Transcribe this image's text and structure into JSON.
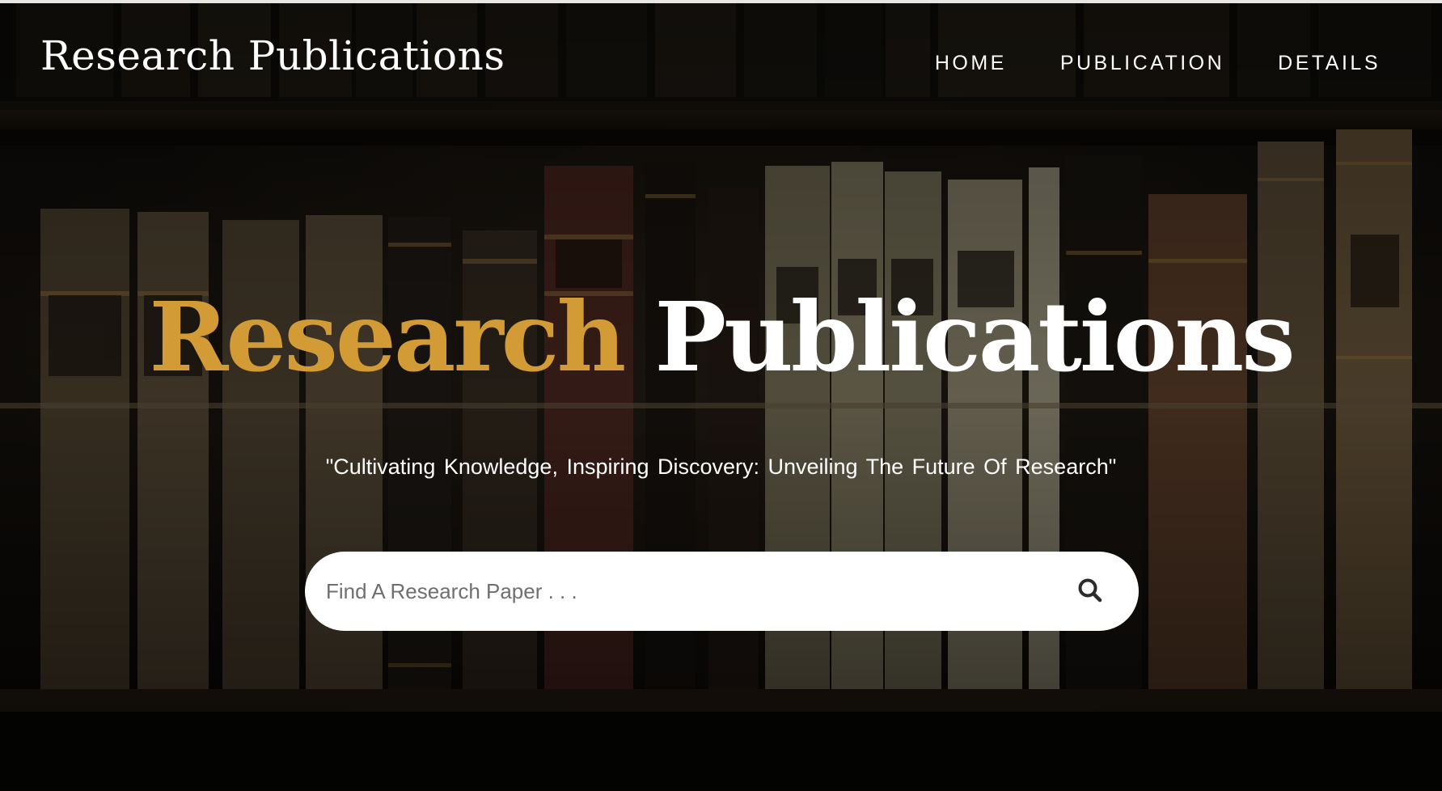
{
  "nav": {
    "brand": "Research Publications",
    "links": [
      {
        "label": "HOME"
      },
      {
        "label": "PUBLICATION"
      },
      {
        "label": "DETAILS"
      }
    ]
  },
  "hero": {
    "title_accent": "Research",
    "title_main": "Publications",
    "tagline": "\"Cultivating Knowledge, Inspiring Discovery: Unveiling The Future Of Research\""
  },
  "search": {
    "placeholder": "Find A Research Paper . . .",
    "value": "",
    "icon": "search-icon"
  },
  "colors": {
    "accent": "#d29b35",
    "text": "#ffffff",
    "background": "#0c0b09"
  }
}
